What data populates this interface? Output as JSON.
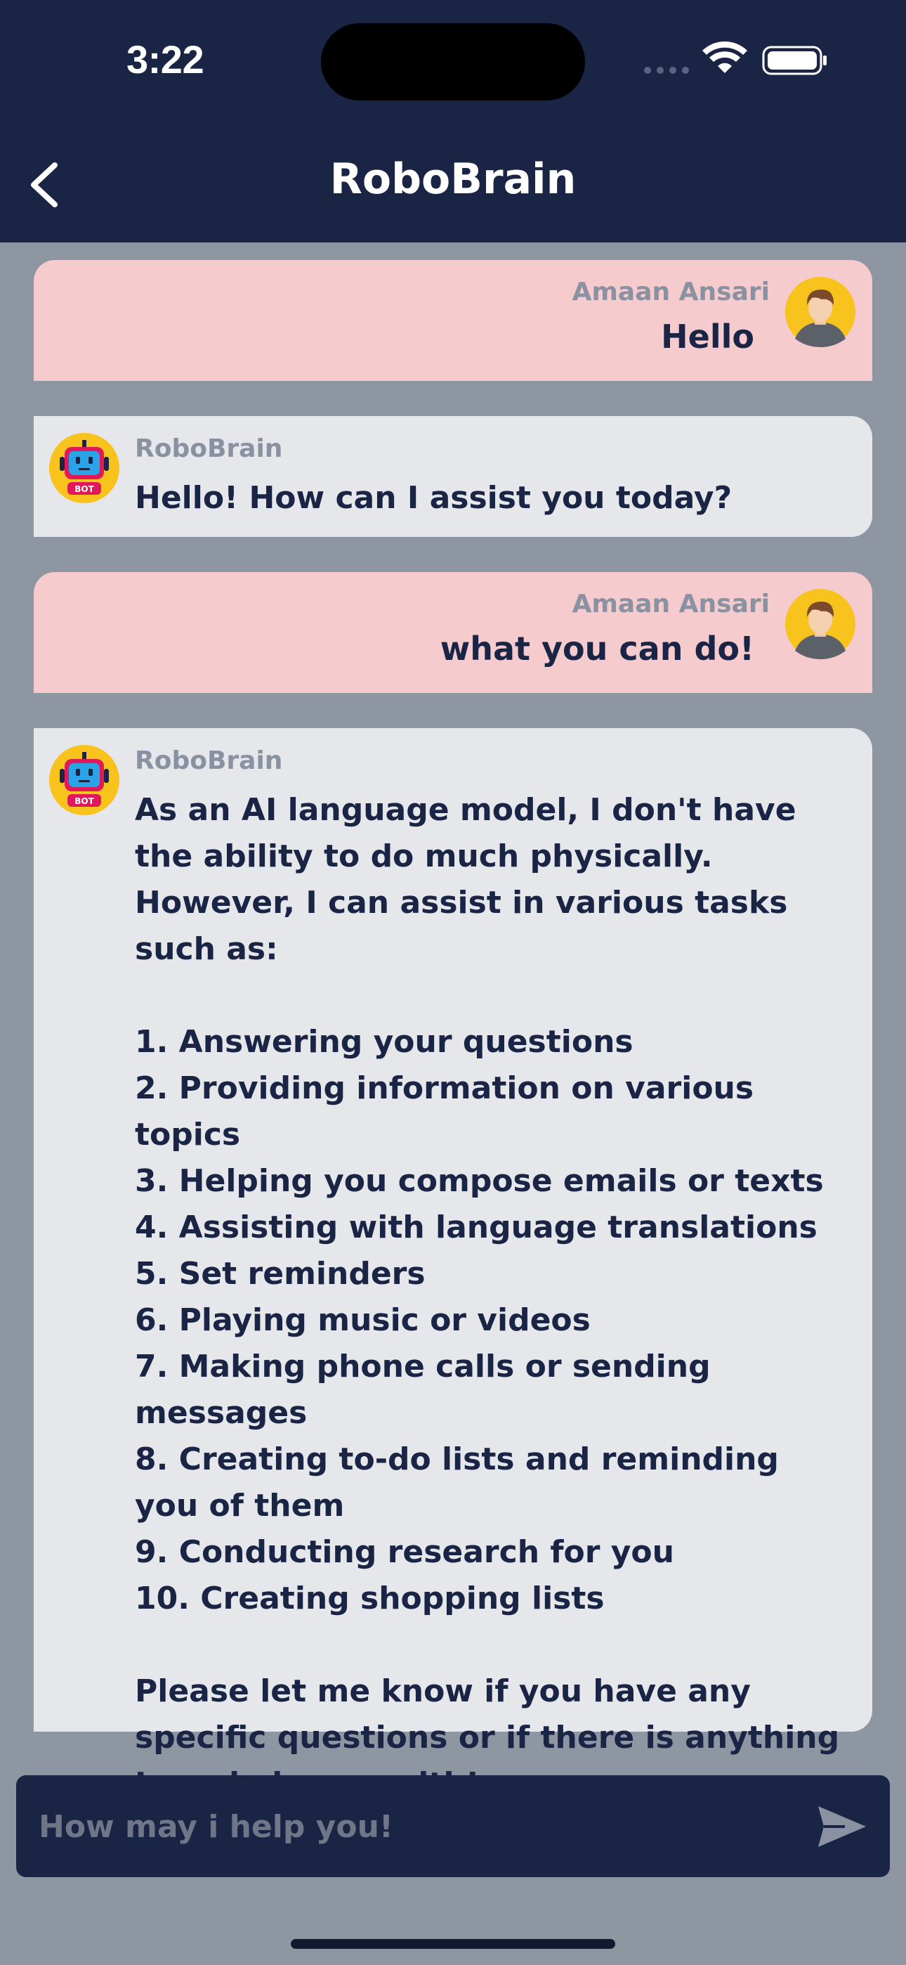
{
  "status_bar": {
    "time": "3:22",
    "icons": [
      "signal-icon",
      "wifi-icon",
      "battery-icon"
    ]
  },
  "header": {
    "title": "RoboBrain",
    "back_icon": "chevron-left-icon"
  },
  "messages": [
    {
      "role": "user",
      "sender": "Amaan Ansari",
      "text": "Hello"
    },
    {
      "role": "bot",
      "sender": "RoboBrain",
      "text": "Hello! How can I assist you today?"
    },
    {
      "role": "user",
      "sender": "Amaan Ansari",
      "text": "what you can do!"
    },
    {
      "role": "bot",
      "sender": "RoboBrain",
      "text": "As an AI language model, I don't have the ability to do much physically. However, I can assist in various tasks such as:\n\n1. Answering your questions\n2. Providing information on various topics\n3. Helping you compose emails or texts\n4. Assisting with language translations\n5. Set reminders\n6. Playing music or videos\n7. Making phone calls or sending messages\n8. Creating to-do lists and reminding you of them\n9. Conducting research for you\n10. Creating shopping lists\n\nPlease let me know if you have any specific questions or if there is anything I can help you with!"
    }
  ],
  "input": {
    "placeholder": "How may i help you!",
    "value": "",
    "send_icon": "send-icon"
  },
  "colors": {
    "navy": "#1a2545",
    "background": "#8e96a2",
    "user_bubble": "#f5cbcd",
    "bot_bubble": "#e6e7eb",
    "sender_gray": "#8a92a2",
    "avatar_yellow": "#f7c31c",
    "bot_badge_red": "#e0195a"
  }
}
